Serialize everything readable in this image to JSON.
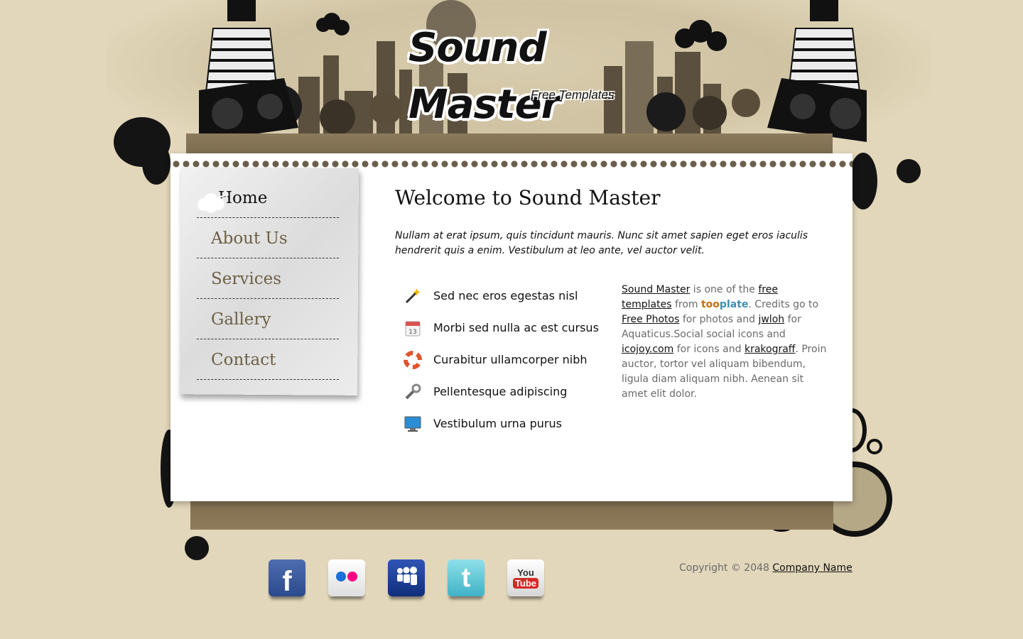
{
  "header": {
    "title": "Sound Master",
    "tagline": "Free Templates"
  },
  "menu": {
    "items": [
      {
        "label": "Home",
        "active": true
      },
      {
        "label": "About Us"
      },
      {
        "label": "Services"
      },
      {
        "label": "Gallery"
      },
      {
        "label": "Contact"
      }
    ]
  },
  "main": {
    "heading": "Welcome to Sound Master",
    "intro": "Nullam at erat ipsum, quis tincidunt mauris. Nunc sit amet sapien eget eros iaculis hendrerit quis a enim. Vestibulum at leo ante, vel auctor velit.",
    "features": [
      {
        "icon": "magic-wand-icon",
        "text": "Sed nec eros egestas nisl"
      },
      {
        "icon": "calendar-icon",
        "icon_text": "13",
        "text": "Morbi sed nulla ac est cursus"
      },
      {
        "icon": "lifebuoy-icon",
        "text": "Curabitur ullamcorper nibh"
      },
      {
        "icon": "wrench-icon",
        "text": "Pellentesque adipiscing"
      },
      {
        "icon": "monitor-icon",
        "text": "Vestibulum urna purus"
      }
    ],
    "credits": {
      "link_sound_master": "Sound Master",
      "t1": " is one of the ",
      "link_free_templates": "free templates",
      "t2": " from ",
      "too": "too",
      "plate": "plate",
      "t3": ". Credits go to ",
      "link_free_photos": "Free Photos",
      "t4": " for photos and ",
      "link_jwloh": "jwloh",
      "t5": " for Aquaticus.Social social icons and ",
      "link_icojoy": "icojoy.com",
      "t6": " for icons and ",
      "link_krakograff": "krakograff",
      "t7": ". Proin auctor, tortor vel aliquam bibendum, ligula diam aliquam nibh. Aenean sit amet elit dolor."
    }
  },
  "footer": {
    "social": [
      {
        "icon": "facebook-icon",
        "glyph": "f",
        "color": "#3b5998"
      },
      {
        "icon": "flickr-icon",
        "color": "#f2f2f2"
      },
      {
        "icon": "myspace-icon",
        "color": "#1c3c94"
      },
      {
        "icon": "twitter-icon",
        "glyph": "t",
        "color": "#5fc7d6"
      },
      {
        "icon": "youtube-icon",
        "glyph_top": "You",
        "glyph_bottom": "Tube",
        "color": "#e8e8e8"
      }
    ],
    "copyright_text": "Copyright © 2048 ",
    "company_link": "Company Name"
  },
  "colors": {
    "background": "#e3d7bb",
    "menu_text": "#6d5f45",
    "tooplate_orange": "#c76d0a",
    "tooplate_blue": "#3a8fb0"
  }
}
